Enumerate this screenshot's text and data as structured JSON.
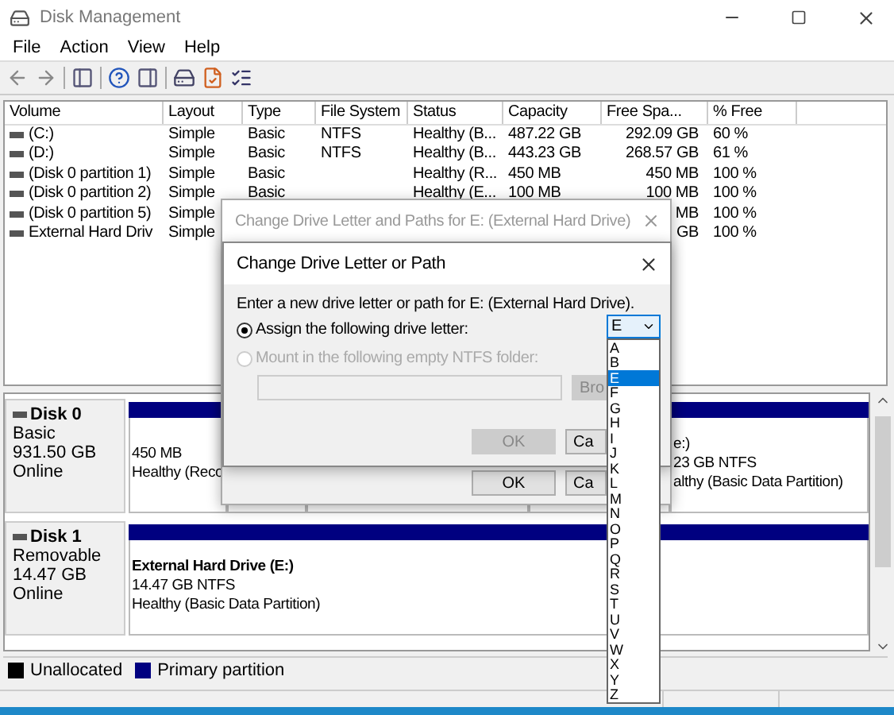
{
  "window": {
    "title": "Disk Management"
  },
  "menu": [
    "File",
    "Action",
    "View",
    "Help"
  ],
  "volumes": {
    "columns": [
      "Volume",
      "Layout",
      "Type",
      "File System",
      "Status",
      "Capacity",
      "Free Spa...",
      "% Free"
    ],
    "rows": [
      {
        "volume": "(C:)",
        "layout": "Simple",
        "type": "Basic",
        "file_system": "NTFS",
        "status": "Healthy (B...",
        "capacity": "487.22 GB",
        "free_space": "292.09 GB",
        "percent_free": "60 %"
      },
      {
        "volume": "(D:)",
        "layout": "Simple",
        "type": "Basic",
        "file_system": "NTFS",
        "status": "Healthy (B...",
        "capacity": "443.23 GB",
        "free_space": "268.57 GB",
        "percent_free": "61 %"
      },
      {
        "volume": "(Disk 0 partition 1)",
        "layout": "Simple",
        "type": "Basic",
        "status": "Healthy (R...",
        "capacity": "450 MB",
        "free_space": "450 MB",
        "percent_free": "100 %"
      },
      {
        "volume": "(Disk 0 partition 2)",
        "layout": "Simple",
        "type": "Basic",
        "status": "Healthy (E...",
        "capacity": "100 MB",
        "free_space": "100 MB",
        "percent_free": "100 %"
      },
      {
        "volume": "(Disk 0 partition 5)",
        "layout": "Simple",
        "free_space": "MB",
        "percent_free": "100 %"
      },
      {
        "volume": "External Hard Driv",
        "layout": "Simple",
        "free_space": "GB",
        "percent_free": "100 %"
      }
    ]
  },
  "disks": [
    {
      "name": "Disk 0",
      "type": "Basic",
      "size": "931.50 GB",
      "state": "Online",
      "partitions": [
        {
          "kind": "partition",
          "lines": [
            "450 MB",
            "Healthy (Reco"
          ]
        },
        {
          "kind": "partition"
        },
        {
          "kind": "partition"
        },
        {
          "kind": "partition"
        },
        {
          "kind": "partition",
          "lines": [
            "e:)",
            "23 GB NTFS",
            "althy (Basic Data Partition)"
          ]
        }
      ]
    },
    {
      "name": "Disk 1",
      "type": "Removable",
      "size": "14.47 GB",
      "state": "Online",
      "partitions": [
        {
          "kind": "partition",
          "lines": [
            "External Hard Drive  (E:)",
            "14.47 GB NTFS",
            "Healthy (Basic Data Partition)"
          ]
        }
      ]
    }
  ],
  "legend": [
    {
      "label": "Unallocated",
      "color": "#000000"
    },
    {
      "label": "Primary partition",
      "color": "#000080"
    }
  ],
  "outer_dialog": {
    "title": "Change Drive Letter and Paths for E: (External Hard Drive)",
    "buttons": [
      "OK",
      "Ca"
    ]
  },
  "dialog": {
    "title": "Change Drive Letter or Path",
    "prompt": "Enter a new drive letter or path for E: (External Hard Drive).",
    "options": [
      {
        "label": "Assign the following drive letter:",
        "selected": true,
        "disabled": false
      },
      {
        "label": "Mount in the following empty NTFS folder:",
        "selected": false,
        "disabled": true
      }
    ],
    "folder_field": {
      "disabled": true
    },
    "browse": {
      "label": "Bro",
      "disabled": true
    },
    "buttons": [
      {
        "label": "OK",
        "disabled": true
      },
      {
        "label": "Ca",
        "disabled": false
      }
    ],
    "drive_letter": {
      "value": "E",
      "options": [
        {
          "label": "A",
          "selected": false
        },
        {
          "label": "B",
          "selected": false
        },
        {
          "label": "E",
          "selected": true
        },
        {
          "label": "F",
          "selected": false
        },
        {
          "label": "G",
          "selected": false
        },
        {
          "label": "H",
          "selected": false
        },
        {
          "label": "I",
          "selected": false
        },
        {
          "label": "J",
          "selected": false
        },
        {
          "label": "K",
          "selected": false
        },
        {
          "label": "L",
          "selected": false
        },
        {
          "label": "M",
          "selected": false
        },
        {
          "label": "N",
          "selected": false
        },
        {
          "label": "O",
          "selected": false
        },
        {
          "label": "P",
          "selected": false
        },
        {
          "label": "Q",
          "selected": false
        },
        {
          "label": "R",
          "selected": false
        },
        {
          "label": "S",
          "selected": false
        },
        {
          "label": "T",
          "selected": false
        },
        {
          "label": "U",
          "selected": false
        },
        {
          "label": "V",
          "selected": false
        },
        {
          "label": "W",
          "selected": false
        },
        {
          "label": "X",
          "selected": false
        },
        {
          "label": "Y",
          "selected": false
        },
        {
          "label": "Z",
          "selected": false
        }
      ]
    }
  }
}
